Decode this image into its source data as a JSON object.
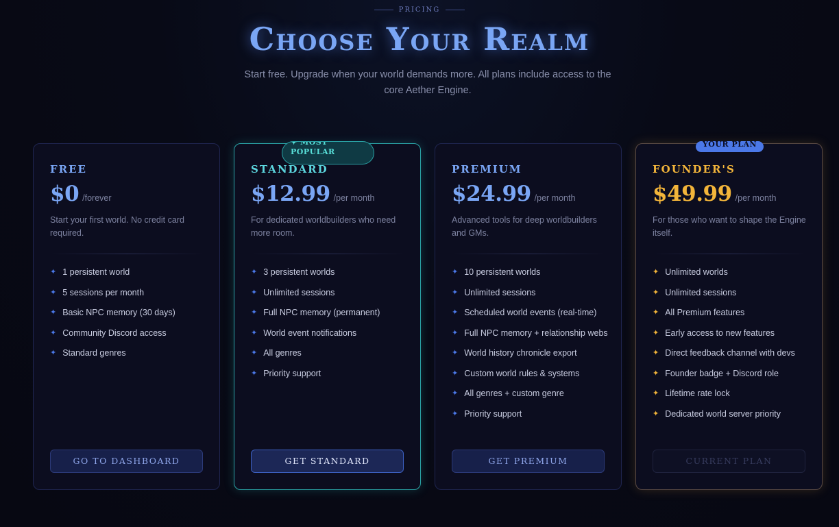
{
  "header": {
    "eyebrow": "PRICING",
    "title": "Choose Your Realm",
    "subtitle": "Start free. Upgrade when your world demands more. All plans include access to the core Aether Engine."
  },
  "colors": {
    "accent": "#7aa6f5",
    "popular": "#2aa3a6",
    "founder": "#f3b53a",
    "background": "#080a16"
  },
  "plans": [
    {
      "name": "FREE",
      "price": "$0",
      "period": "/forever",
      "description": "Start your first world. No credit card required.",
      "features": [
        "1 persistent world",
        "5 sessions per month",
        "Basic NPC memory (30 days)",
        "Community Discord access",
        "Standard genres"
      ],
      "button": "GO TO DASHBOARD"
    },
    {
      "name": "STANDARD",
      "price": "$12.99",
      "period": "/per month",
      "badge": "✦ MOST POPULAR",
      "description": "For dedicated worldbuilders who need more room.",
      "features": [
        "3 persistent worlds",
        "Unlimited sessions",
        "Full NPC memory (permanent)",
        "World event notifications",
        "All genres",
        "Priority support"
      ],
      "button": "GET STANDARD"
    },
    {
      "name": "PREMIUM",
      "price": "$24.99",
      "period": "/per month",
      "description": "Advanced tools for deep worldbuilders and GMs.",
      "features": [
        "10 persistent worlds",
        "Unlimited sessions",
        "Scheduled world events (real-time)",
        "Full NPC memory + relationship webs",
        "World history chronicle export",
        "Custom world rules & systems",
        "All genres + custom genre",
        "Priority support"
      ],
      "button": "GET PREMIUM"
    },
    {
      "name": "FOUNDER'S",
      "price": "$49.99",
      "period": "/per month",
      "badge": "YOUR PLAN",
      "description": "For those who want to shape the Engine itself.",
      "features": [
        "Unlimited worlds",
        "Unlimited sessions",
        "All Premium features",
        "Early access to new features",
        "Direct feedback channel with devs",
        "Founder badge + Discord role",
        "Lifetime rate lock",
        "Dedicated world server priority"
      ],
      "button": "CURRENT PLAN"
    }
  ],
  "icons": {
    "feature_bullet": "sparkle-icon"
  }
}
